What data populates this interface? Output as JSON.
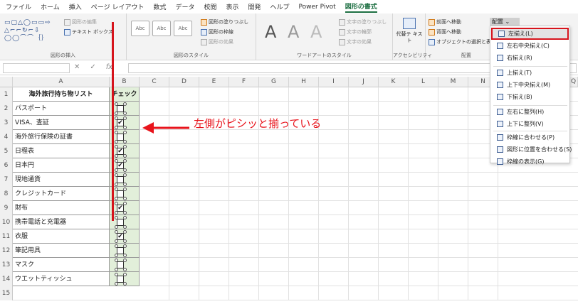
{
  "ribbon_tabs": [
    "ファイル",
    "ホーム",
    "挿入",
    "ページ レイアウト",
    "数式",
    "データ",
    "校閲",
    "表示",
    "開発",
    "ヘルプ",
    "Power Pivot",
    "図形の書式"
  ],
  "ribbon": {
    "insert_shapes": {
      "edit_shape": "図形の編集",
      "text_box": "テキスト ボックス",
      "label": "図形の挿入"
    },
    "shape_styles": {
      "style_sample": "Abc",
      "fill": "図形の塗りつぶし",
      "outline": "図形の枠線",
      "effects": "図形の効果",
      "label": "図形のスタイル"
    },
    "wordart": {
      "glyph": "A",
      "text_fill": "文字の塗りつぶし",
      "text_outline": "文字の輪郭",
      "text_effects": "文字の効果",
      "label": "ワードアートのスタイル"
    },
    "accessibility": {
      "alt_text": "代替テ キスト",
      "label": "アクセシビリティ"
    },
    "arrange": {
      "bring_forward": "前面へ移動",
      "send_backward": "背面へ移動",
      "selection_pane": "オブジェクトの選択と表示",
      "label": "配置",
      "align_button": "配置"
    }
  },
  "formula_bar": {
    "fx": "fx"
  },
  "columns": [
    "A",
    "B",
    "C",
    "D",
    "E",
    "F",
    "G",
    "H",
    "I",
    "J",
    "K",
    "L",
    "M",
    "N"
  ],
  "extra_column": "Q",
  "table": {
    "header_a": "海外旅行持ち物リスト",
    "header_b": "チェック",
    "rows": [
      {
        "num": "2",
        "item": "パスポート",
        "checked": false
      },
      {
        "num": "3",
        "item": "VISA、査証",
        "checked": true
      },
      {
        "num": "4",
        "item": "海外旅行保険の証書",
        "checked": false
      },
      {
        "num": "5",
        "item": "日程表",
        "checked": true
      },
      {
        "num": "6",
        "item": "日本円",
        "checked": true
      },
      {
        "num": "7",
        "item": "現地通貨",
        "checked": false
      },
      {
        "num": "8",
        "item": "クレジットカード",
        "checked": false
      },
      {
        "num": "9",
        "item": "財布",
        "checked": true
      },
      {
        "num": "10",
        "item": "携帯電話と充電器",
        "checked": false
      },
      {
        "num": "11",
        "item": "衣服",
        "checked": true
      },
      {
        "num": "12",
        "item": "筆記用具",
        "checked": false
      },
      {
        "num": "13",
        "item": "マスク",
        "checked": false
      },
      {
        "num": "14",
        "item": "ウエットティッシュ",
        "checked": false
      }
    ]
  },
  "row_one": "1",
  "row_fifteen": "15",
  "checkmark": "✔",
  "annotation": "左側がピシッと揃っている",
  "align_menu": [
    {
      "label": "左揃え(L)",
      "highlighted": true
    },
    {
      "label": "左右中央揃え(C)",
      "highlighted": false
    },
    {
      "label": "右揃え(R)",
      "highlighted": false
    },
    {
      "label": "上揃え(T)",
      "highlighted": false
    },
    {
      "label": "上下中央揃え(M)",
      "highlighted": false
    },
    {
      "label": "下揃え(B)",
      "highlighted": false
    },
    {
      "label": "左右に整列(H)",
      "highlighted": false
    },
    {
      "label": "上下に整列(V)",
      "highlighted": false
    },
    {
      "label": "枠線に合わせる(P)",
      "highlighted": false
    },
    {
      "label": "図形に位置を合わせる(S)",
      "highlighted": false
    },
    {
      "label": "枠線の表示(G)",
      "highlighted": false
    }
  ],
  "colors": {
    "accent_green": "#1d6f42",
    "annotation_red": "#e8141c",
    "check_column_fill": "#e2efda"
  }
}
